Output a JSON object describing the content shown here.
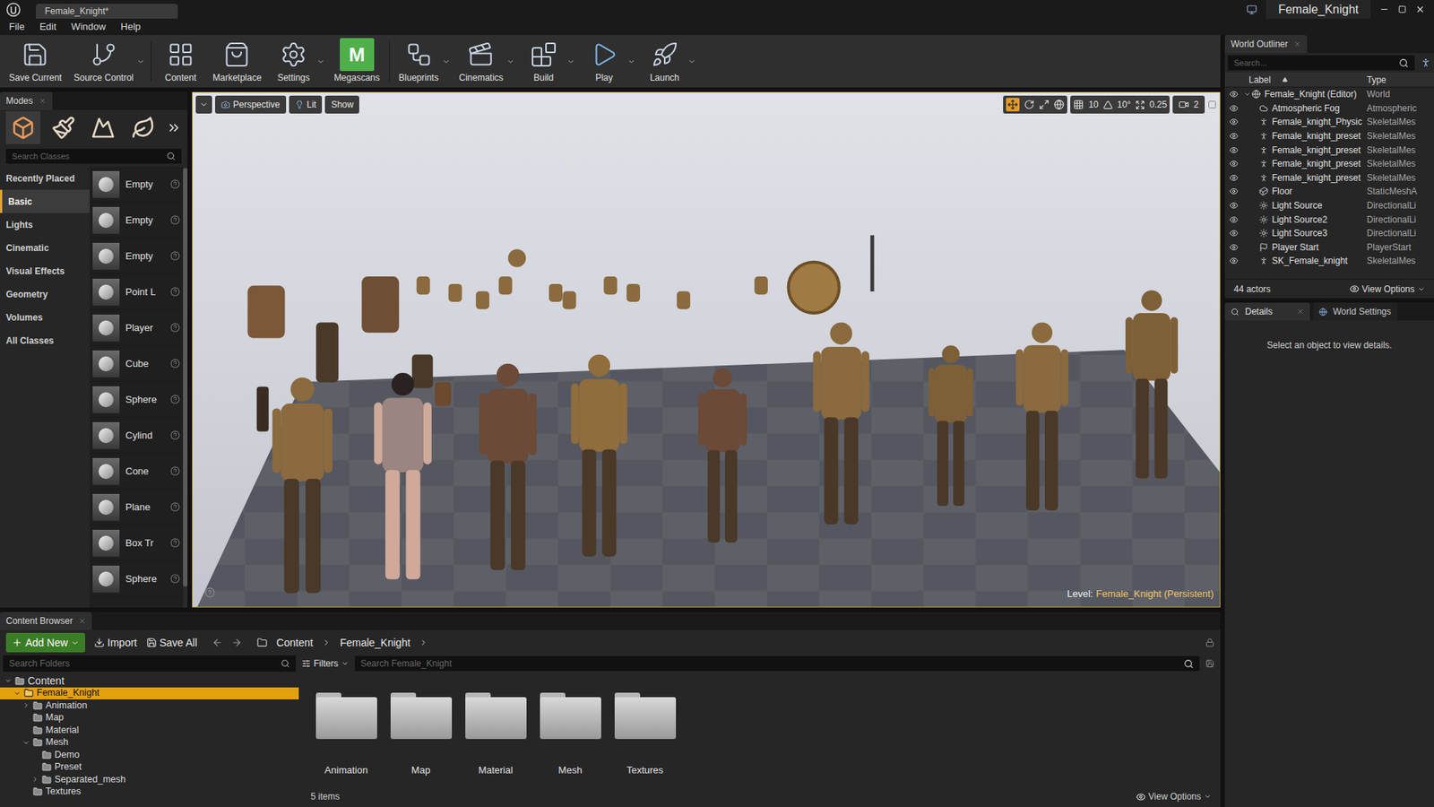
{
  "window": {
    "tab": "Female_Knight*",
    "title": "Female_Knight"
  },
  "menu": [
    "File",
    "Edit",
    "Window",
    "Help"
  ],
  "toolbar": [
    {
      "label": "Save Current",
      "dropdown": false
    },
    {
      "label": "Source Control",
      "dropdown": true
    },
    {
      "label": "Content",
      "dropdown": false
    },
    {
      "label": "Marketplace",
      "dropdown": false
    },
    {
      "label": "Settings",
      "dropdown": true
    },
    {
      "label": "Megascans",
      "dropdown": false,
      "logo": "M"
    },
    {
      "label": "Blueprints",
      "dropdown": true
    },
    {
      "label": "Cinematics",
      "dropdown": true
    },
    {
      "label": "Build",
      "dropdown": true
    },
    {
      "label": "Play",
      "dropdown": true
    },
    {
      "label": "Launch",
      "dropdown": true
    }
  ],
  "modes": {
    "title": "Modes",
    "search": {
      "placeholder": "Search Classes"
    },
    "categories": [
      {
        "label": "Recently Placed",
        "selected": false
      },
      {
        "label": "Basic",
        "selected": true
      },
      {
        "label": "Lights",
        "selected": false
      },
      {
        "label": "Cinematic",
        "selected": false
      },
      {
        "label": "Visual Effects",
        "selected": false
      },
      {
        "label": "Geometry",
        "selected": false
      },
      {
        "label": "Volumes",
        "selected": false
      },
      {
        "label": "All Classes",
        "selected": false
      }
    ],
    "items": [
      "Empty",
      "Empty",
      "Empty",
      "Point L",
      "Player",
      "Cube",
      "Sphere",
      "Cylind",
      "Cone",
      "Plane",
      "Box Tr",
      "Sphere"
    ]
  },
  "viewport": {
    "view": "Perspective",
    "lighting": "Lit",
    "show": "Show",
    "grid_snap": "10",
    "rotation_snap": "10°",
    "scale_snap": "0.25",
    "camera_speed": "2",
    "level_label": "Level:",
    "level": "Female_Knight (Persistent)"
  },
  "outliner": {
    "title": "World Outliner",
    "search": {
      "placeholder": "Search..."
    },
    "columns": [
      {
        "label": "Label",
        "sorted": true
      },
      {
        "label": "Type",
        "sorted": false
      }
    ],
    "rows": [
      {
        "label": "Female_Knight (Editor)",
        "type": "World",
        "kind": "world",
        "expanded": true
      },
      {
        "label": "Atmospheric Fog",
        "type": "Atmospheric",
        "kind": "fog",
        "expanded": false
      },
      {
        "label": "Female_knight_Physic",
        "type": "SkeletalMes",
        "kind": "mesh",
        "expanded": false
      },
      {
        "label": "Female_knight_preset",
        "type": "SkeletalMes",
        "kind": "mesh",
        "expanded": false
      },
      {
        "label": "Female_knight_preset",
        "type": "SkeletalMes",
        "kind": "mesh",
        "expanded": false
      },
      {
        "label": "Female_knight_preset",
        "type": "SkeletalMes",
        "kind": "mesh",
        "expanded": false
      },
      {
        "label": "Female_knight_preset",
        "type": "SkeletalMes",
        "kind": "mesh",
        "expanded": false
      },
      {
        "label": "Floor",
        "type": "StaticMeshA",
        "kind": "static",
        "expanded": false
      },
      {
        "label": "Light Source",
        "type": "DirectionalLi",
        "kind": "light",
        "expanded": false
      },
      {
        "label": "Light Source2",
        "type": "DirectionalLi",
        "kind": "light",
        "expanded": false
      },
      {
        "label": "Light Source3",
        "type": "DirectionalLi",
        "kind": "light",
        "expanded": false
      },
      {
        "label": "Player Start",
        "type": "PlayerStart",
        "kind": "start",
        "expanded": false
      },
      {
        "label": "SK_Female_knight",
        "type": "SkeletalMes",
        "kind": "mesh",
        "expanded": false
      }
    ],
    "count": "44 actors",
    "view_options": "View Options"
  },
  "details": {
    "tabs": [
      {
        "label": "Details",
        "selected": true
      },
      {
        "label": "World Settings",
        "selected": false
      }
    ],
    "empty_message": "Select an object to view details."
  },
  "content_browser": {
    "title": "Content Browser",
    "add_new": "Add New",
    "import": "Import",
    "save_all": "Save All",
    "path": [
      "Content",
      "Female_Knight"
    ],
    "folder_search": {
      "placeholder": "Search Folders"
    },
    "filters": "Filters",
    "asset_search": {
      "placeholder": "Search Female_Knight"
    },
    "tree": [
      {
        "label": "Content",
        "depth": 0,
        "expandable": true,
        "expanded": true,
        "selected": false
      },
      {
        "label": "Female_Knight",
        "depth": 1,
        "expandable": true,
        "expanded": true,
        "selected": true
      },
      {
        "label": "Animation",
        "depth": 2,
        "expandable": true,
        "expanded": false,
        "selected": false
      },
      {
        "label": "Map",
        "depth": 2,
        "expandable": false,
        "expanded": false,
        "selected": false
      },
      {
        "label": "Material",
        "depth": 2,
        "expandable": false,
        "expanded": false,
        "selected": false
      },
      {
        "label": "Mesh",
        "depth": 2,
        "expandable": true,
        "expanded": true,
        "selected": false
      },
      {
        "label": "Demo",
        "depth": 3,
        "expandable": false,
        "expanded": false,
        "selected": false
      },
      {
        "label": "Preset",
        "depth": 3,
        "expandable": false,
        "expanded": false,
        "selected": false
      },
      {
        "label": "Separated_mesh",
        "depth": 3,
        "expandable": true,
        "expanded": false,
        "selected": false
      },
      {
        "label": "Textures",
        "depth": 2,
        "expandable": false,
        "expanded": false,
        "selected": false
      }
    ],
    "assets": [
      "Animation",
      "Map",
      "Material",
      "Mesh",
      "Textures"
    ],
    "count": "5 items",
    "view_options": "View Options"
  }
}
